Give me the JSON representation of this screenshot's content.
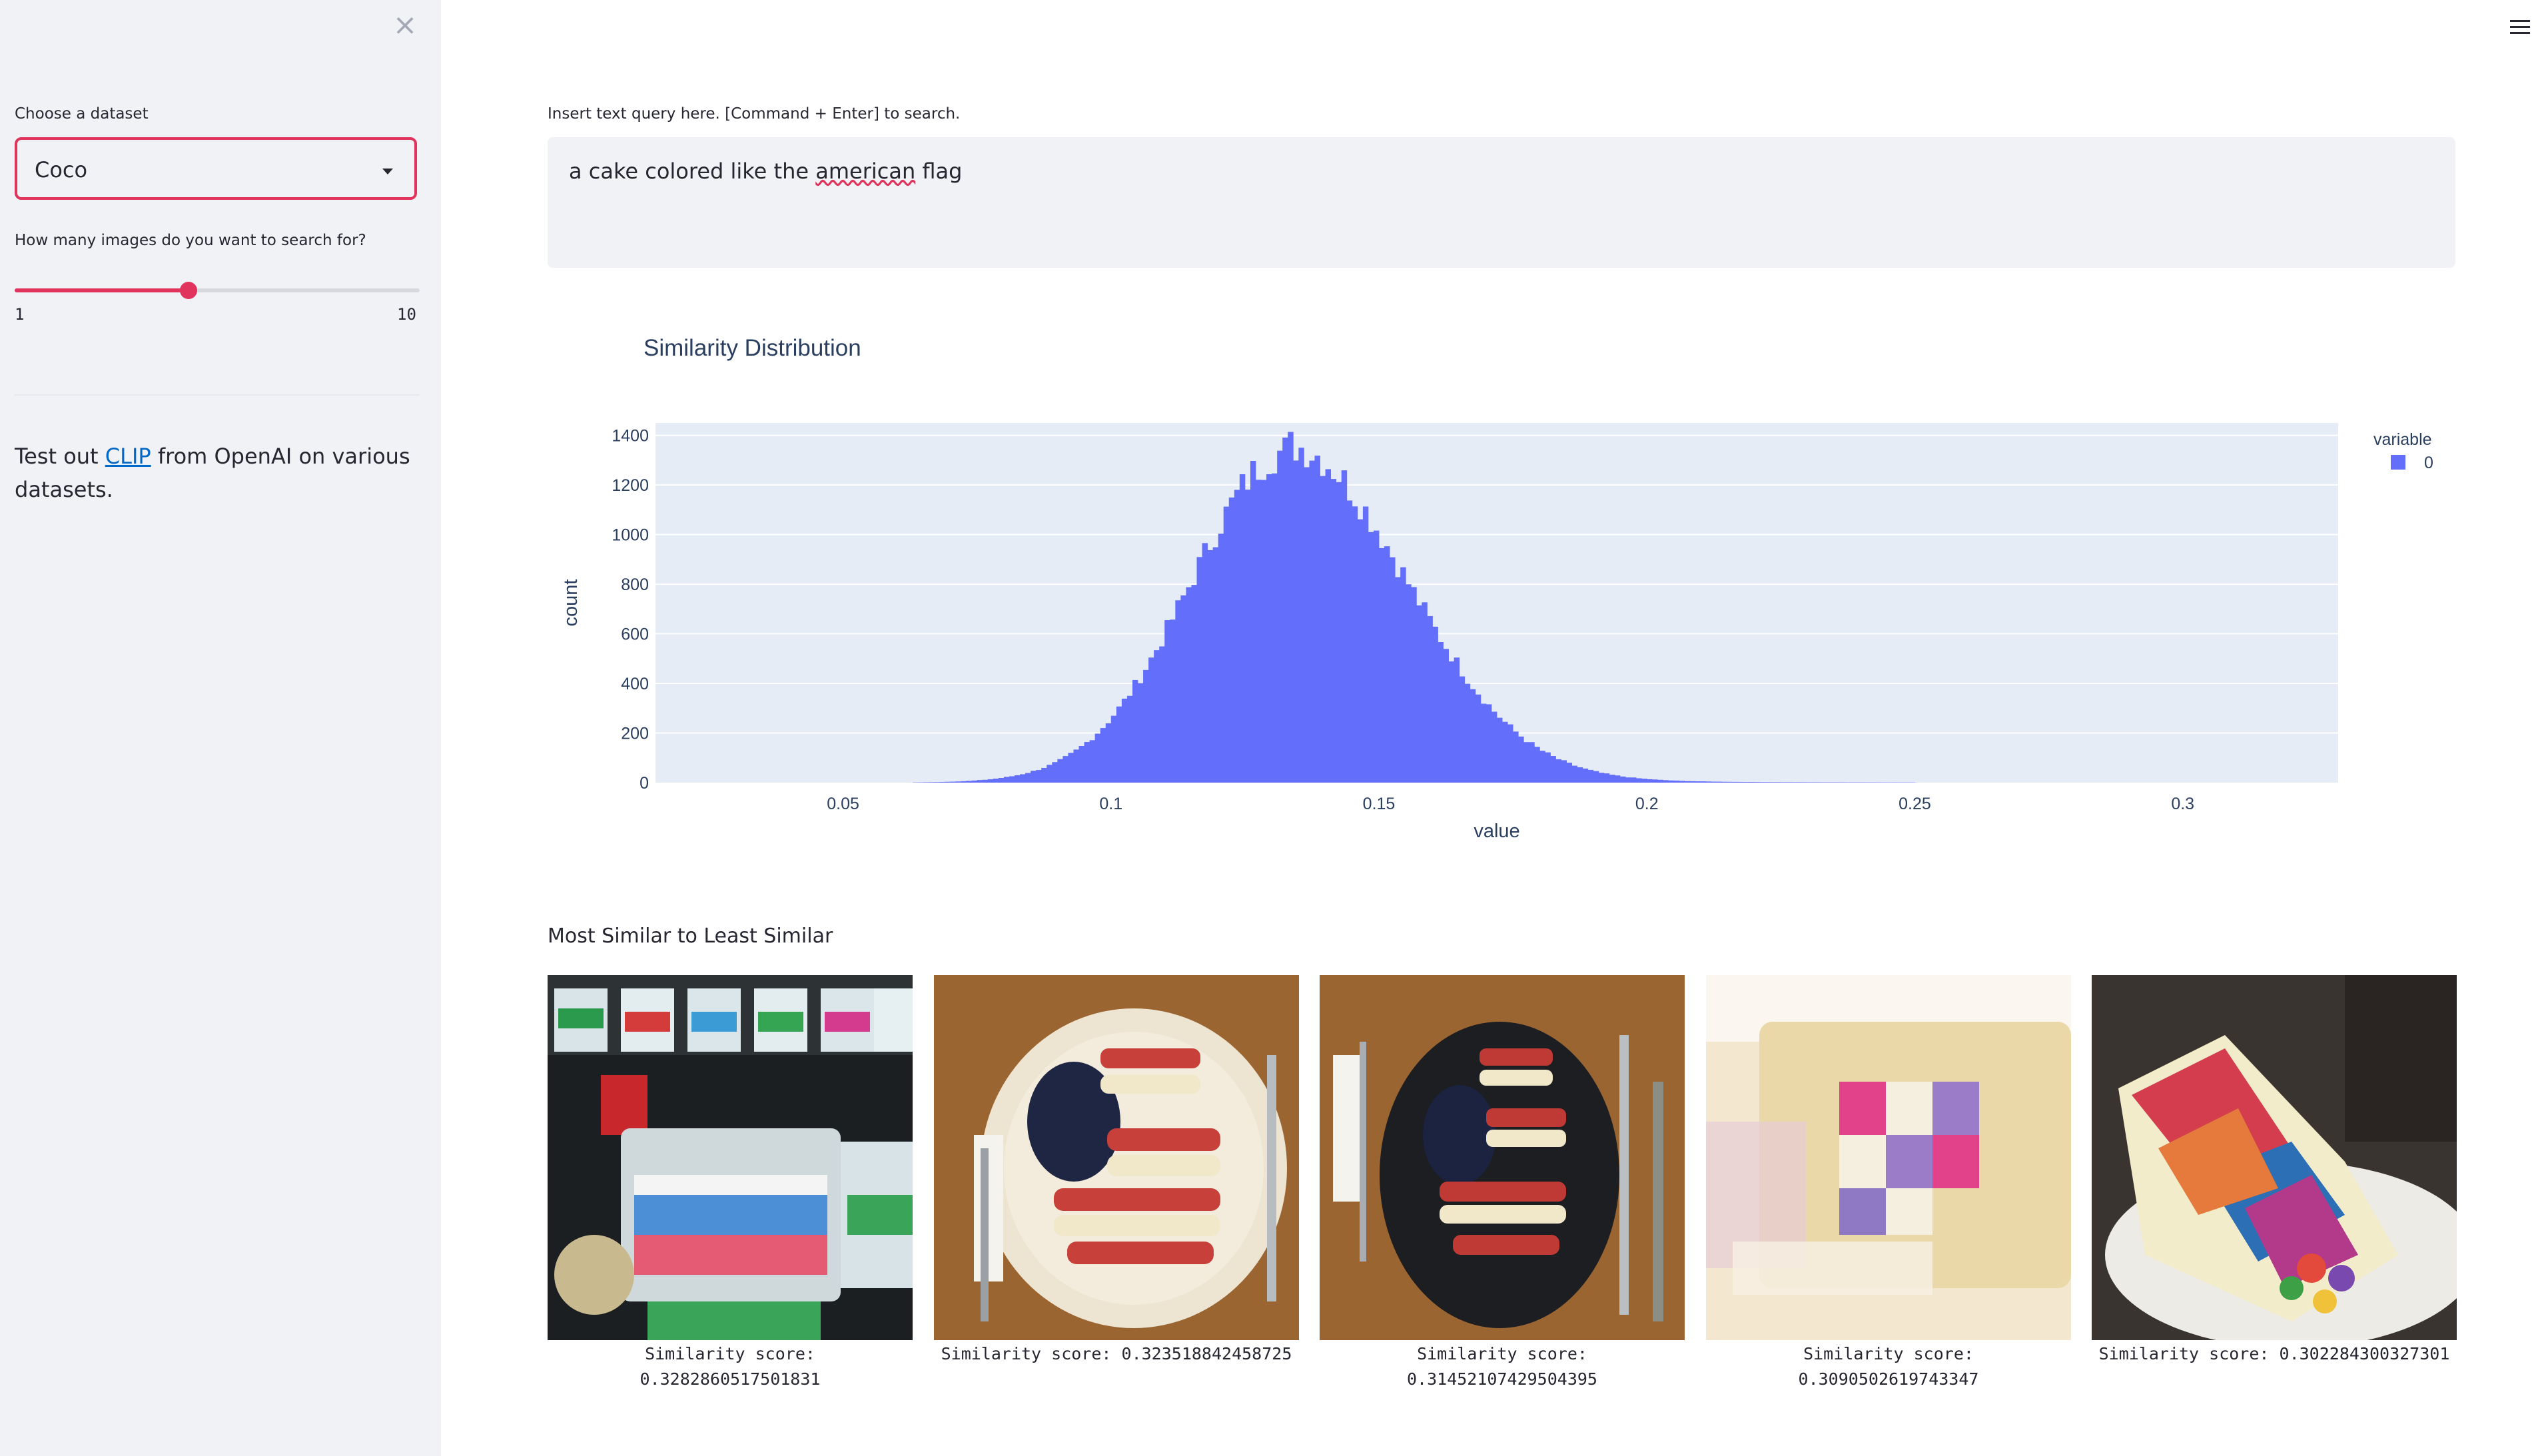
{
  "sidebar": {
    "close_glyph": "×",
    "dataset_label": "Choose a dataset",
    "dataset_value": "Coco",
    "count_label": "How many images do you want to search for?",
    "slider": {
      "min": 1,
      "max": 10,
      "min_label": "1",
      "max_label": "10",
      "value_fraction": 0.43
    },
    "description_pre": "Test out ",
    "description_link": "CLIP",
    "description_post": " from OpenAI on various datasets."
  },
  "main": {
    "query_label": "Insert text query here. [Command + Enter] to search.",
    "query_pre": "a cake colored like the ",
    "query_misspelled": "american",
    "query_post": " flag",
    "results_heading": "Most Similar to Least Similar",
    "results": [
      {
        "caption": "Similarity score:\n0.3282860517501831",
        "image": "store-shelf-cakes"
      },
      {
        "caption": "Similarity score: 0.323518842458725",
        "image": "flag-plate-white"
      },
      {
        "caption": "Similarity score:\n0.31452107429504395",
        "image": "flag-plate-black"
      },
      {
        "caption": "Similarity score:\n0.3090502619743347",
        "image": "checkered-cake"
      },
      {
        "caption": "Similarity score: 0.302284300327301",
        "image": "rainbow-cake"
      }
    ]
  },
  "chart_data": {
    "type": "bar",
    "title": "Similarity Distribution",
    "xlabel": "value",
    "ylabel": "count",
    "legend_title": "variable",
    "series": [
      {
        "name": "0",
        "color": "#636efa"
      }
    ],
    "xlim": [
      0.015,
      0.329
    ],
    "ylim": [
      0,
      1450
    ],
    "x_ticks": [
      0.05,
      0.1,
      0.15,
      0.2,
      0.25,
      0.3
    ],
    "x_tick_labels": [
      "0.05",
      "0.1",
      "0.15",
      "0.2",
      "0.25",
      "0.3"
    ],
    "y_ticks": [
      0,
      200,
      400,
      600,
      800,
      1000,
      1200,
      1400
    ],
    "y_tick_labels": [
      "0",
      "200",
      "400",
      "600",
      "800",
      "1000",
      "1200",
      "1400"
    ],
    "legend_placement": "top-right",
    "grid": true,
    "bin_width": 0.001,
    "distribution": {
      "peak_x": 0.1335,
      "peak_count": 1340,
      "sigma_left": 0.0185,
      "sigma_right": 0.0215
    }
  }
}
